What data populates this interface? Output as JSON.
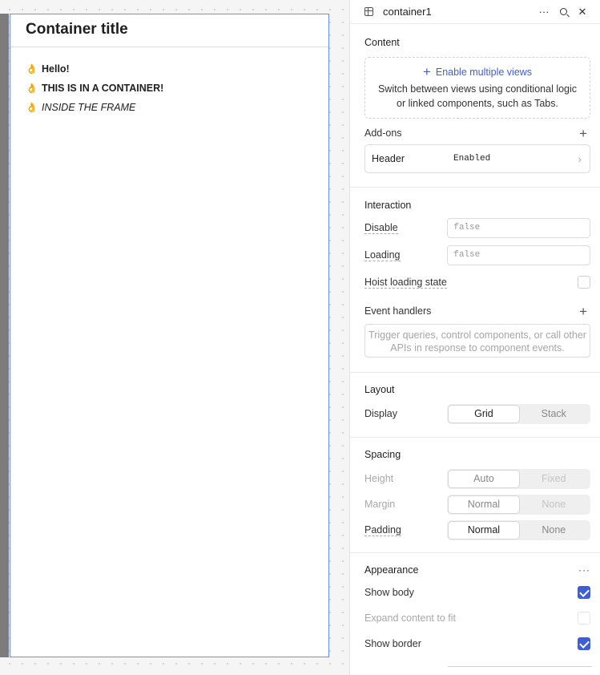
{
  "canvas": {
    "container": {
      "title": "Container title",
      "lines": [
        {
          "icon": "👌",
          "text": "Hello!"
        },
        {
          "icon": "👌",
          "text": "THIS IS IN A CONTAINER!"
        },
        {
          "icon": "👌",
          "text": "INSIDE THE FRAME"
        }
      ]
    }
  },
  "inspector": {
    "component_name": "container1",
    "more_label": "···",
    "content": {
      "title": "Content",
      "enable_views_label": "Enable multiple views",
      "enable_views_desc": "Switch between views using conditional logic or linked components, such as Tabs."
    },
    "addons": {
      "title": "Add-ons",
      "plus": "+",
      "items": [
        {
          "name": "Header",
          "status": "Enabled",
          "chevron": "›"
        }
      ]
    },
    "interaction": {
      "title": "Interaction",
      "disable_label": "Disable",
      "disable_value": "false",
      "loading_label": "Loading",
      "loading_value": "false",
      "hoist_label": "Hoist loading state",
      "hoist_checked": false,
      "event_handlers_label": "Event handlers",
      "event_handlers_plus": "+",
      "event_handlers_placeholder": "Trigger queries, control components, or call other APIs in response to component events."
    },
    "layout": {
      "title": "Layout",
      "display_label": "Display",
      "options": [
        "Grid",
        "Stack"
      ],
      "selected": "Grid"
    },
    "spacing": {
      "title": "Spacing",
      "height_label": "Height",
      "height_options": [
        "Auto",
        "Fixed"
      ],
      "margin_label": "Margin",
      "margin_options": [
        "Normal",
        "None"
      ],
      "padding_label": "Padding",
      "padding_options": [
        "Normal",
        "None"
      ]
    },
    "appearance": {
      "title": "Appearance",
      "more": "···",
      "show_body_label": "Show body",
      "show_body_checked": true,
      "expand_label": "Expand content to fit",
      "expand_checked": false,
      "show_border_label": "Show border",
      "show_border_checked": true
    }
  }
}
